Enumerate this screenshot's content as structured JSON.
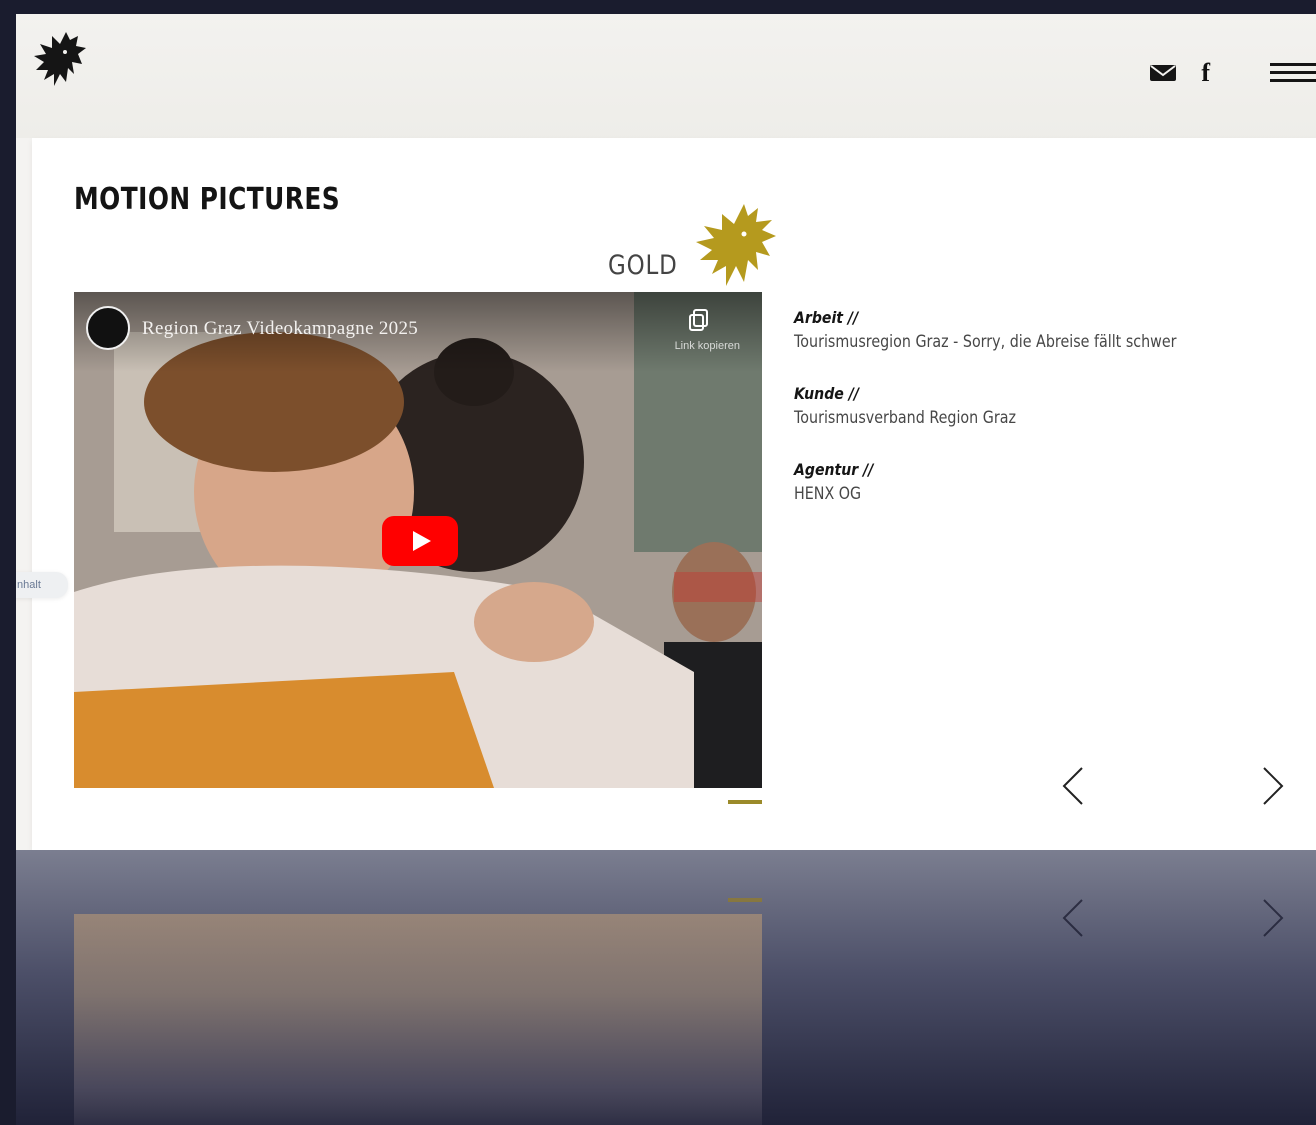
{
  "header": {
    "logo_icon": "dragon-logo-icon",
    "mail_icon": "mail-icon",
    "facebook_label": "f",
    "menu_icon": "hamburger-menu-icon"
  },
  "page": {
    "title": "MOTION PICTURES",
    "award_label": "GOLD",
    "award_icon": "gold-dragon-award-icon"
  },
  "video": {
    "title": "Region Graz Videokampagne 2025",
    "copy_label": "Link kopieren",
    "play_icon": "youtube-play-icon"
  },
  "details": [
    {
      "label": "Arbeit //",
      "value": "Tourismusregion Graz - Sorry, die Abreise fällt schwer"
    },
    {
      "label": "Kunde //",
      "value": "Tourismusverband Region Graz"
    },
    {
      "label": "Agentur //",
      "value": "HENX OG"
    }
  ],
  "side_tab": {
    "label": "Inhalt"
  },
  "nav": {
    "prev_icon": "chevron-left-icon",
    "next_icon": "chevron-right-icon"
  },
  "colors": {
    "accent_gold": "#b59a1e",
    "indicator": "#9b8a2a",
    "play_red": "#ff0000",
    "backdrop": "#1a1c2e"
  }
}
